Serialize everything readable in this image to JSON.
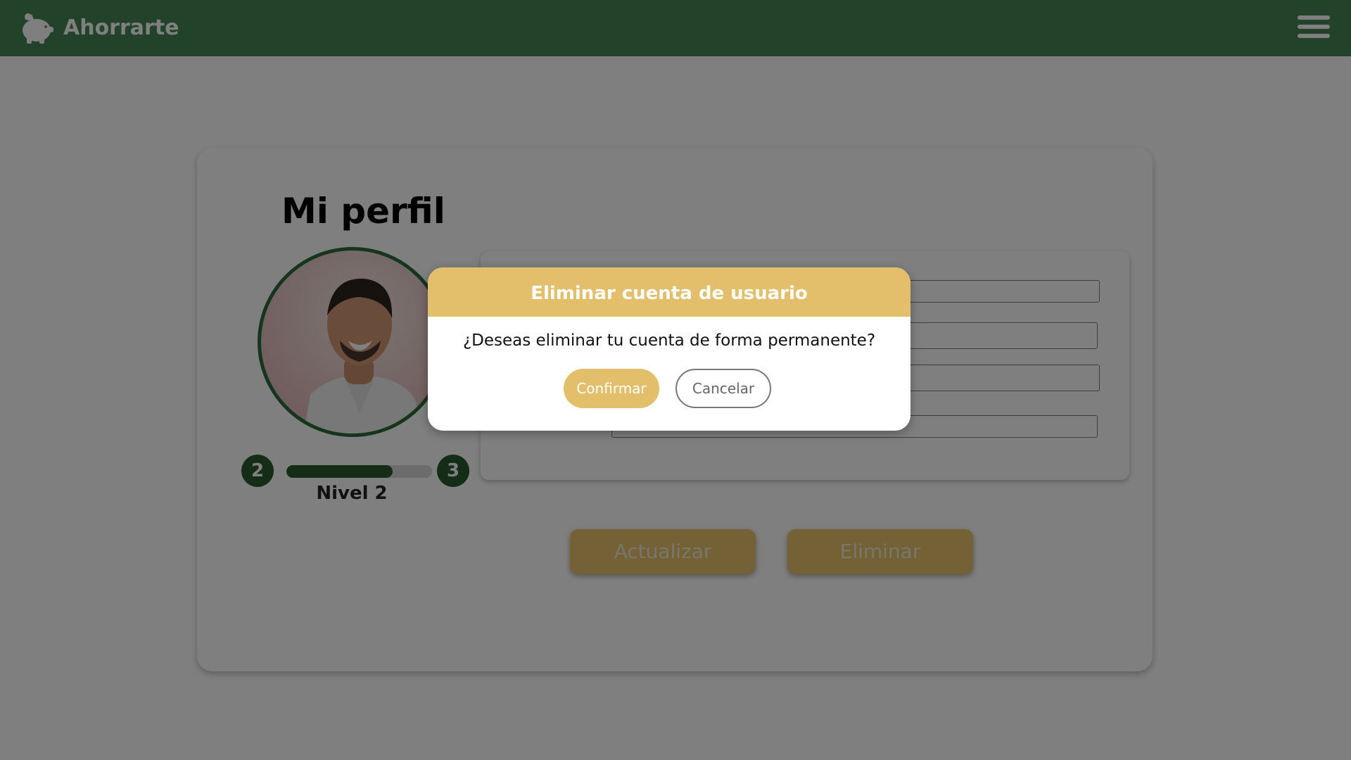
{
  "navbar": {
    "brand": "Ahorrarte",
    "color": "#448455"
  },
  "profile": {
    "title": "Mi perfil",
    "level": {
      "current": "2",
      "next": "3",
      "label": "Nivel 2",
      "progress_fraction": 0.73
    }
  },
  "actions": {
    "update_label": "Actualizar",
    "delete_label": "Eliminar",
    "accent": "#e8c26a"
  },
  "modal": {
    "title": "Eliminar cuenta de usuario",
    "question": "¿Deseas eliminar tu cuenta de forma permanente?",
    "confirm_label": "Confirmar",
    "cancel_label": "Cancelar",
    "header_color": "#e3be6b"
  },
  "icons": {
    "logo": "piggy-bank-icon",
    "menu": "hamburger-menu-icon"
  }
}
